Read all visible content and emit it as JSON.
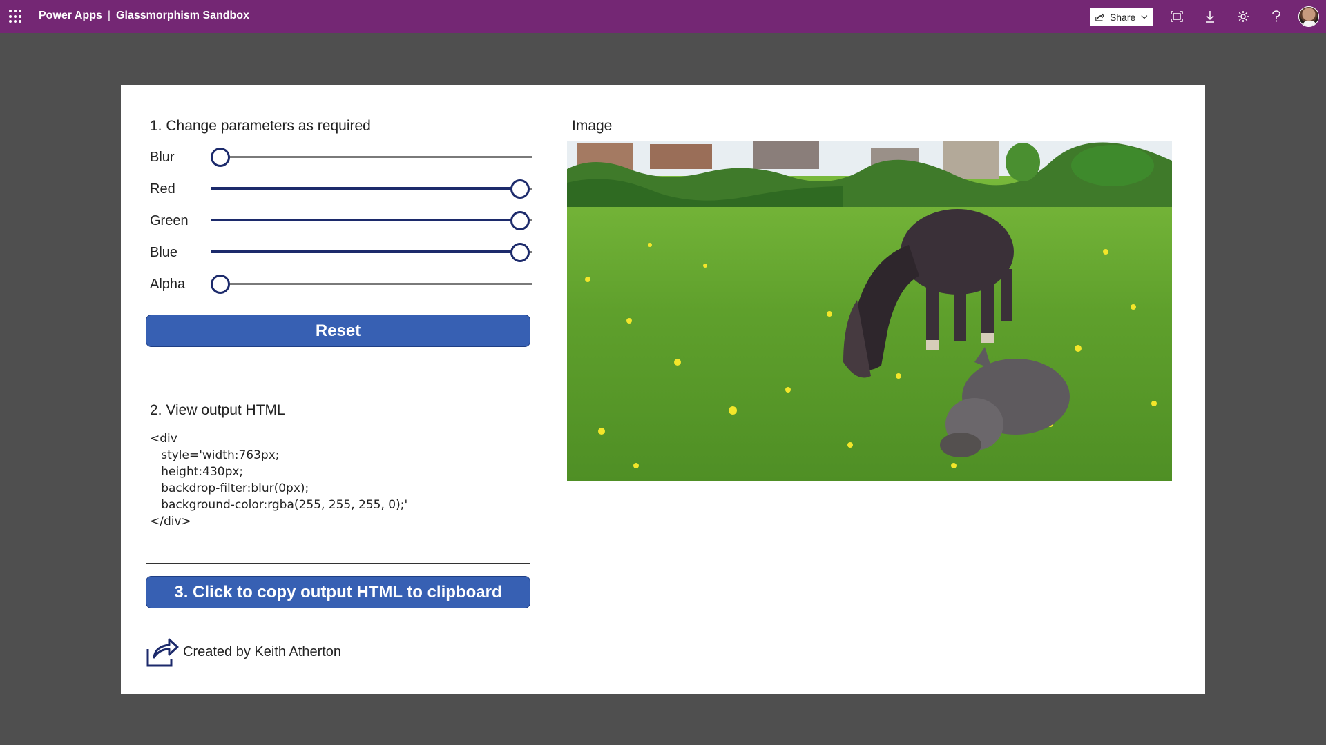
{
  "topbar": {
    "app": "Power Apps",
    "separator": "|",
    "title": "Glassmorphism Sandbox",
    "share_label": "Share",
    "icons": [
      "waffle-icon",
      "share-icon",
      "chevron-down-icon",
      "fit-to-screen-icon",
      "download-icon",
      "gear-icon",
      "help-icon",
      "avatar"
    ]
  },
  "section1": {
    "heading": "1. Change parameters as required",
    "sliders": [
      {
        "label": "Blur",
        "value": 0
      },
      {
        "label": "Red",
        "value": 1
      },
      {
        "label": "Green",
        "value": 1
      },
      {
        "label": "Blue",
        "value": 1
      },
      {
        "label": "Alpha",
        "value": 0
      }
    ],
    "reset_label": "Reset"
  },
  "section2": {
    "heading": "2. View output HTML",
    "output": "<div\n   style='width:763px;\n   height:430px;\n   backdrop-filter:blur(0px);\n   background-color:rgba(255, 255, 255, 0);'\n</div>",
    "copy_label": "3. Click to copy output HTML to clipboard"
  },
  "image": {
    "heading": "Image"
  },
  "credit": {
    "text": "Created by Keith Atherton"
  },
  "colors": {
    "topbar": "#742774",
    "button": "#3760b3",
    "slider": "#1c2a6b",
    "backdrop": "#4f4f4f"
  }
}
